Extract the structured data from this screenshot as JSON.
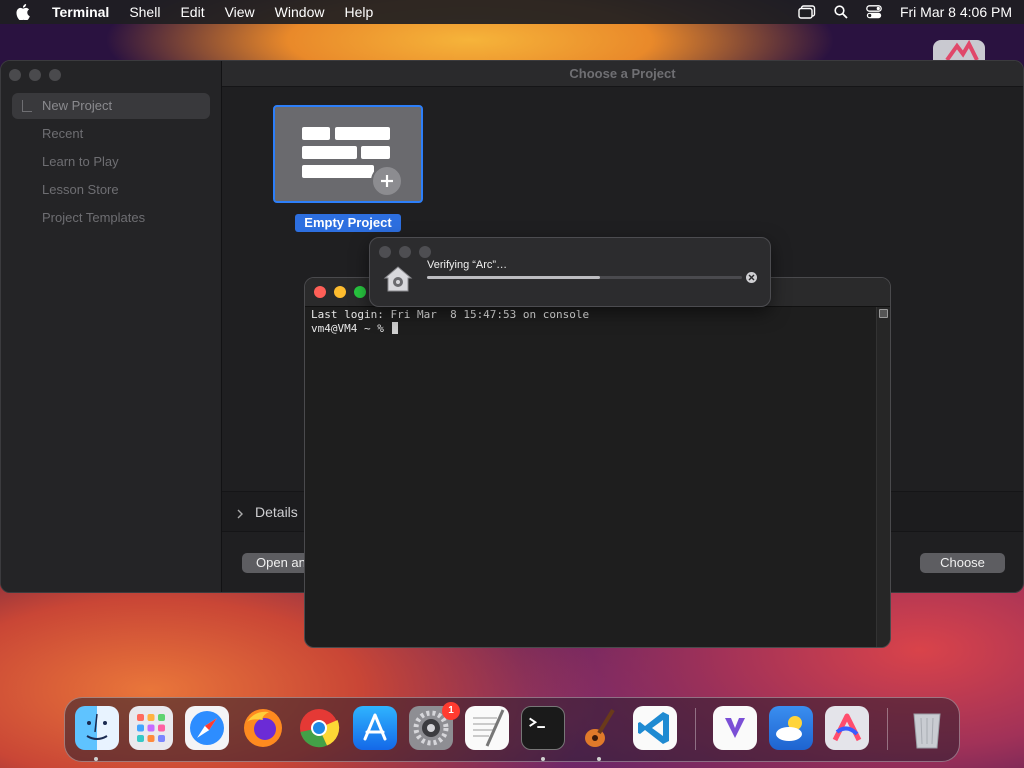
{
  "menubar": {
    "app_name": "Terminal",
    "items": [
      "Shell",
      "Edit",
      "View",
      "Window",
      "Help"
    ],
    "clock": "Fri Mar 8  4:06 PM"
  },
  "chooser": {
    "title": "Choose a Project",
    "sidebar": [
      "New Project",
      "Recent",
      "Learn to Play",
      "Lesson Store",
      "Project Templates"
    ],
    "tile_label": "Empty Project",
    "details_label": "Details",
    "open_button": "Open an",
    "choose_button": "Choose"
  },
  "verify": {
    "message": "Verifying “Arc”…",
    "progress": 0.55
  },
  "terminal": {
    "line1": "Last login: Fri Mar  8 15:47:53 on console",
    "prompt": "vm4@VM4 ~ % "
  },
  "dock": {
    "badge_settings": "1",
    "icons": [
      "finder-icon",
      "launchpad-icon",
      "safari-icon",
      "firefox-icon",
      "chrome-icon",
      "app-store-icon",
      "system-settings-icon",
      "textedit-icon",
      "terminal-icon",
      "garageband-icon",
      "vscode-icon",
      "visual-studio-icon",
      "weather-icon",
      "arc-icon",
      "trash-icon"
    ]
  }
}
